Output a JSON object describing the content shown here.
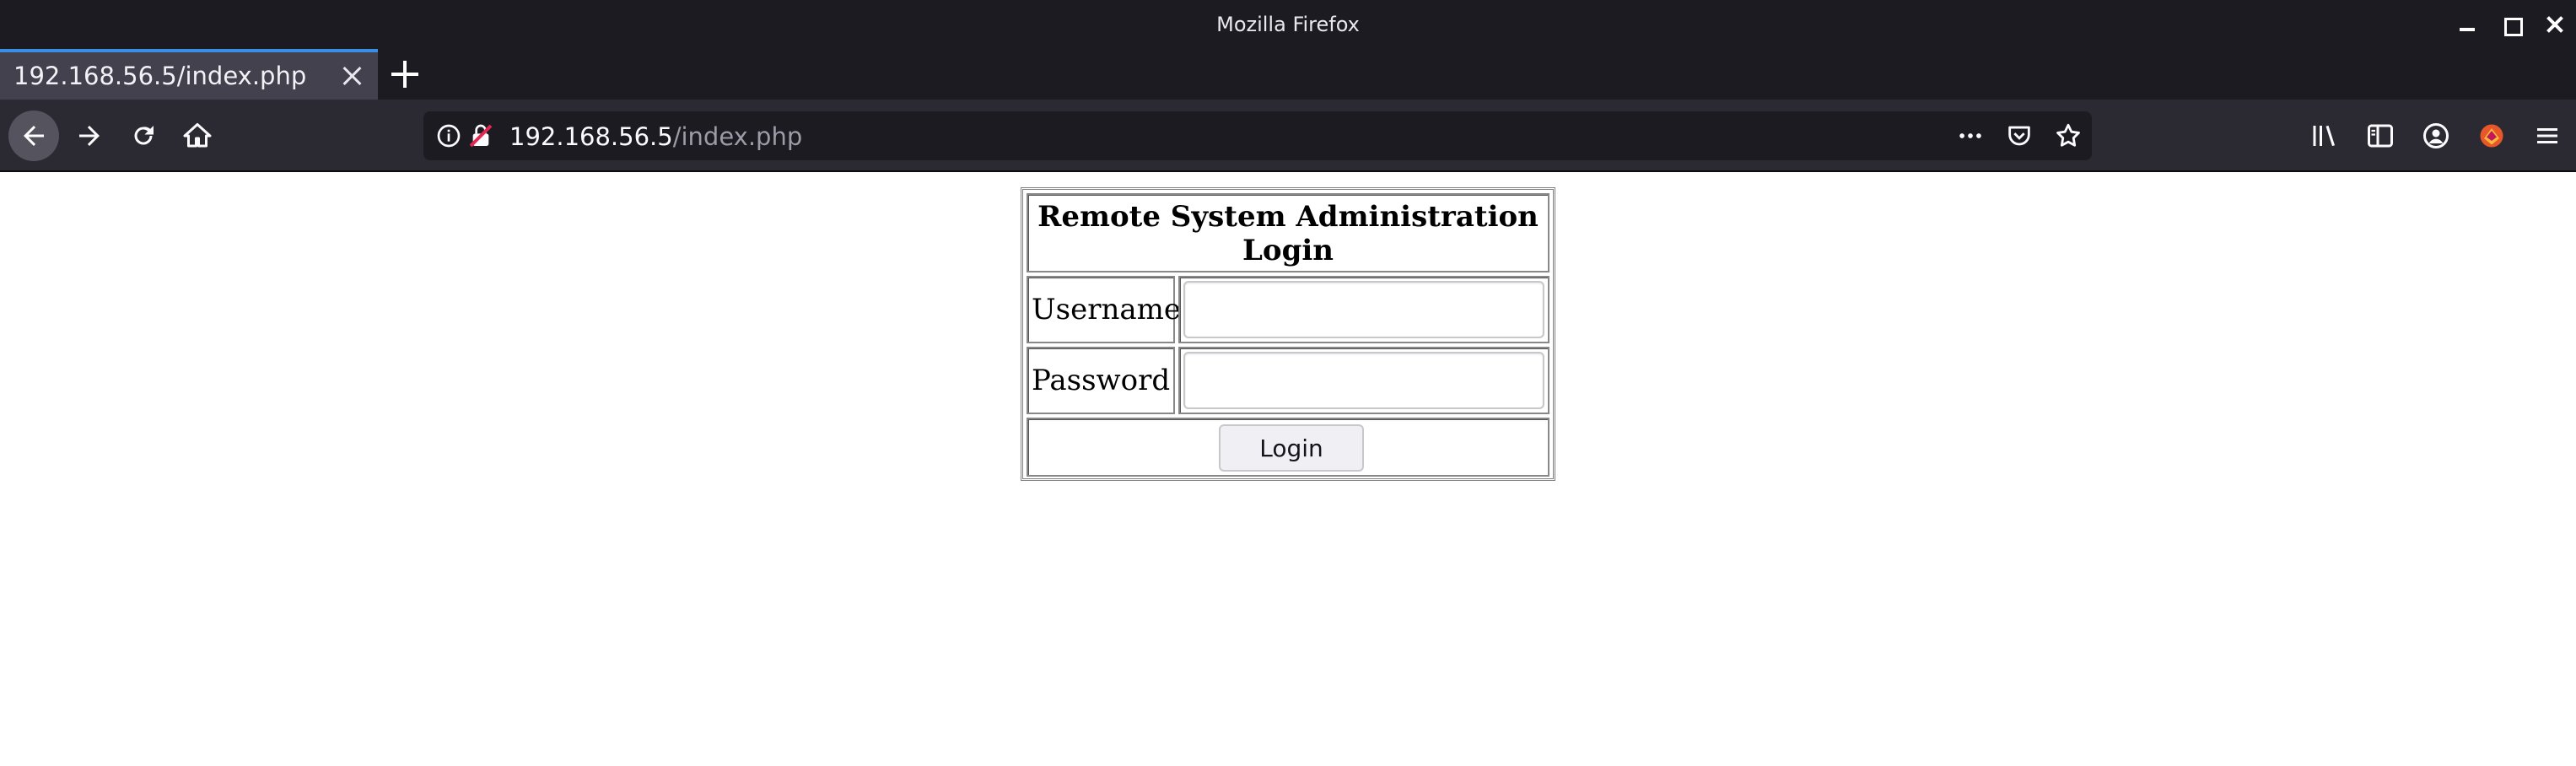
{
  "window": {
    "title": "Mozilla Firefox"
  },
  "tabs": [
    {
      "label": "192.168.56.5/index.php",
      "active": true
    }
  ],
  "urlbar": {
    "host": "192.168.56.5",
    "path": "/index.php"
  },
  "icons": {
    "back": "back-arrow-icon",
    "forward": "forward-arrow-icon",
    "reload": "reload-icon",
    "home": "home-icon",
    "site_info": "info-icon",
    "insecure": "insecure-lock-icon",
    "more": "more-dots-icon",
    "pocket": "pocket-icon",
    "bookmark": "star-icon",
    "library": "library-icon",
    "sidebar": "sidebar-icon",
    "account": "account-icon",
    "extension": "extension-icon",
    "menu": "hamburger-menu-icon"
  },
  "colors": {
    "chrome_dark": "#1c1b22",
    "toolbar": "#2b2a33",
    "tab_active": "#42414d",
    "tab_accent": "#3a8ee6"
  },
  "login_form": {
    "heading": "Remote System Administration Login",
    "username_label": "Username",
    "username_value": "",
    "password_label": "Password",
    "password_value": "",
    "submit_label": "Login"
  }
}
